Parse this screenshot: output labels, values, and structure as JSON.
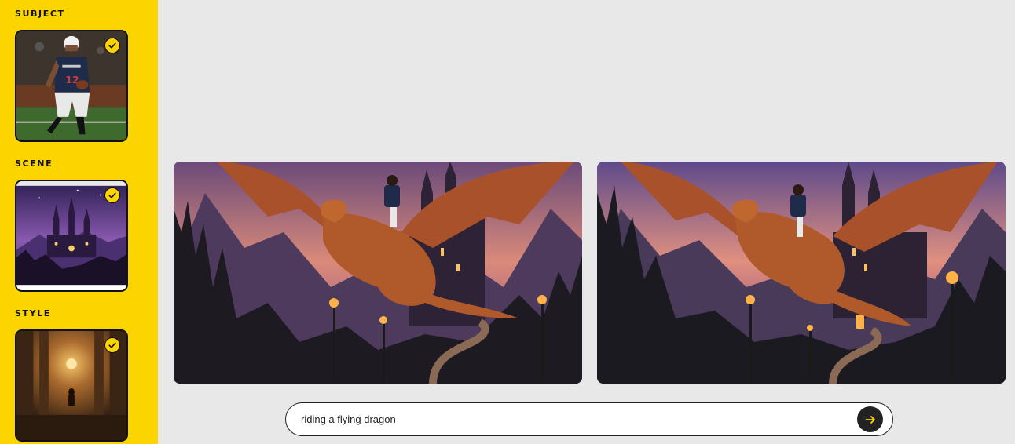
{
  "sidebar": {
    "sections": [
      {
        "label": "SUBJECT",
        "selected": true
      },
      {
        "label": "SCENE",
        "selected": true
      },
      {
        "label": "STYLE",
        "selected": true
      }
    ]
  },
  "icons": {
    "selected": "check-circle-icon",
    "submit": "arrow-right-icon"
  },
  "colors": {
    "accent": "#fcd500",
    "canvas": "#e8e8e8",
    "button": "#222222"
  },
  "results": {
    "count": 2
  },
  "prompt": {
    "value": "riding a flying dragon"
  }
}
